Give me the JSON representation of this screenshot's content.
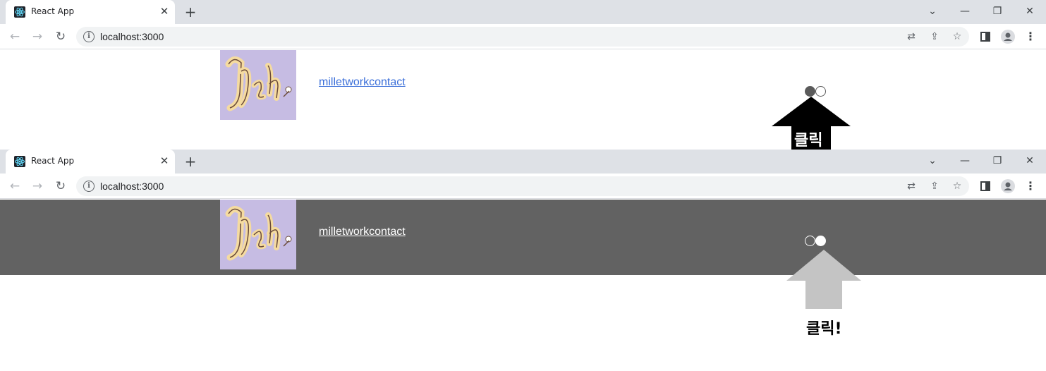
{
  "browser": {
    "tab_title": "React App",
    "tab_close": "✕",
    "new_tab": "+",
    "url": "localhost:3000",
    "window_controls": [
      "⌄",
      "—",
      "❐",
      "✕"
    ]
  },
  "header": {
    "logo_text": "Ysh",
    "link_label": "milletworkcontact"
  },
  "annotations": {
    "top_label": "클릭",
    "bottom_label": "클릭!"
  },
  "themes": {
    "light_bg": "#ffffff",
    "dark_bg": "#626262",
    "logo_bg": "#c6bce3",
    "link_light": "#3b6fd9",
    "link_dark": "#ffffff",
    "arrow_top": "#000000",
    "arrow_bottom": "#c4c4c4"
  },
  "toggle": {
    "top_state": "light",
    "bottom_state": "dark"
  }
}
